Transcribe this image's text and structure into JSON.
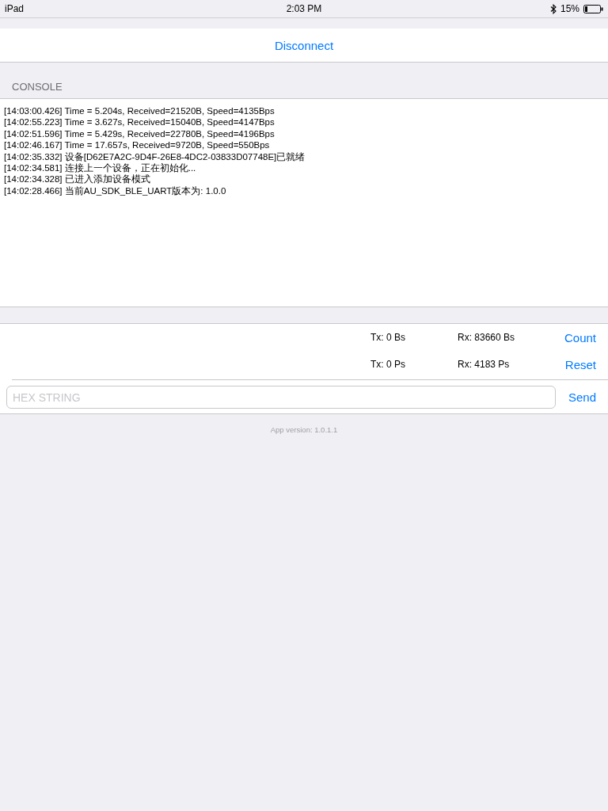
{
  "status_bar": {
    "device": "iPad",
    "time": "2:03 PM",
    "battery": "15%"
  },
  "connect_button": "Disconnect",
  "console": {
    "header": "CONSOLE",
    "lines": [
      "[14:03:00.426] Time = 5.204s, Received=21520B, Speed=4135Bps",
      "[14:02:55.223] Time = 3.627s, Received=15040B, Speed=4147Bps",
      "[14:02:51.596] Time = 5.429s, Received=22780B, Speed=4196Bps",
      "[14:02:46.167] Time = 17.657s, Received=9720B, Speed=550Bps",
      "[14:02:35.332] 设备[D62E7A2C-9D4F-26E8-4DC2-03833D07748E]已就绪",
      "[14:02:34.581] 连接上一个设备，正在初始化...",
      "[14:02:34.328] 已进入添加设备模式",
      "[14:02:28.466] 当前AU_SDK_BLE_UART版本为: 1.0.0"
    ]
  },
  "stats": [
    {
      "tx": "Tx: 0 Bs",
      "rx": "Rx: 83660 Bs",
      "button": "Count"
    },
    {
      "tx": "Tx: 0 Ps",
      "rx": "Rx: 4183 Ps",
      "button": "Reset"
    }
  ],
  "input": {
    "placeholder": "HEX STRING",
    "button": "Send"
  },
  "footer": "App version: 1.0.1.1"
}
